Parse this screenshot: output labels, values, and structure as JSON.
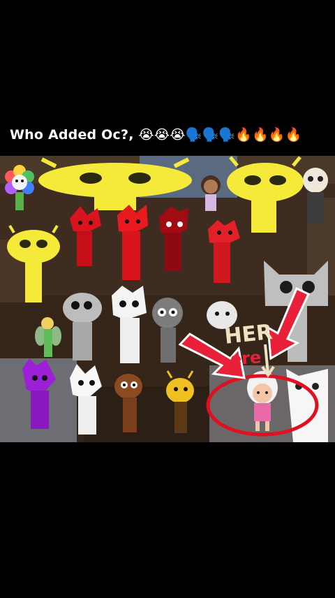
{
  "post": {
    "caption": "Who Added Oc?, 😭😭😭🗣️🗣️🗣️🔥🔥🔥🔥"
  },
  "overlay": {
    "handwriting_line1": "HER",
    "handwriting_line2": "ere"
  },
  "colors": {
    "background": "#000000",
    "caption_text": "#ffffff",
    "scene_brown": "#3a2a1d",
    "arrow_red": "#e8203a",
    "circle_red": "#e01020"
  },
  "characters": [
    "rainbow-flower-character-icon",
    "yellow-antenna-head-large-icon",
    "brown-haired-girl-character-icon",
    "yellow-antenna-head-right-icon",
    "skull-mask-character-icon",
    "yellow-antenna-head-left-icon",
    "red-spiky-character-1-icon",
    "red-spiky-character-2-icon",
    "red-spiky-character-3-icon",
    "red-spiky-character-4-icon",
    "gray-cat-character-icon",
    "gray-spiky-character-icon",
    "white-spiky-character-icon",
    "dark-gray-character-icon",
    "white-scribble-character-icon",
    "green-fairy-character-icon",
    "purple-cat-character-icon",
    "white-cat-character-icon",
    "brown-character-icon",
    "yellow-character-icon",
    "white-haired-oc-girl-icon",
    "white-cat-right-icon"
  ]
}
